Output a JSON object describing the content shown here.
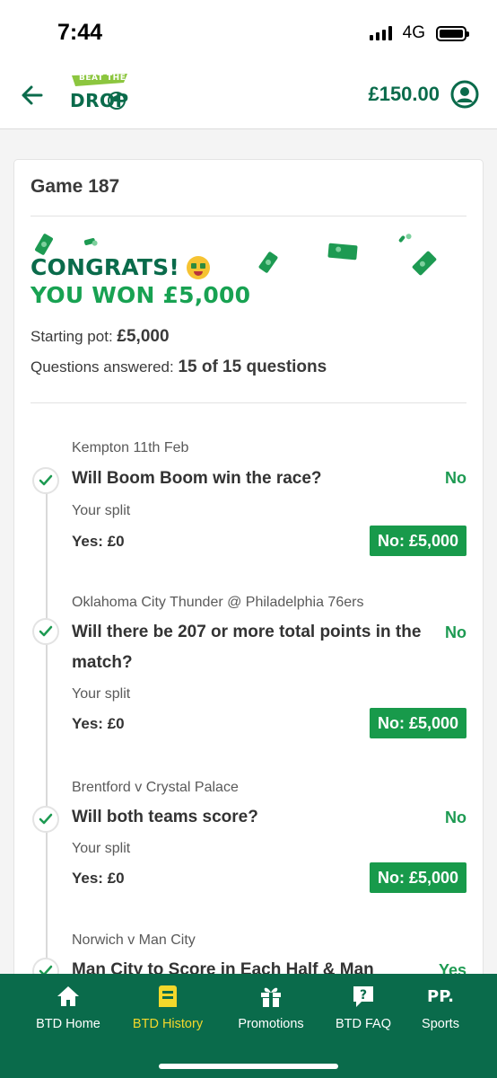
{
  "status": {
    "time": "7:44",
    "network": "4G"
  },
  "header": {
    "logo_top": "BEAT THE",
    "logo_bottom": "DROP",
    "balance": "£150.00"
  },
  "game": {
    "title": "Game 187",
    "congrats": "CONGRATS!",
    "won": "YOU WON £5,000",
    "starting_pot_label": "Starting pot:",
    "starting_pot_value": "£5,000",
    "questions_label": "Questions answered:",
    "questions_value": "15 of 15 questions"
  },
  "questions": [
    {
      "event": "Kempton 11th Feb",
      "text": "Will Boom Boom win the race?",
      "answer": "No",
      "split_label": "Your split",
      "yes": "Yes: £0",
      "no": "No: £5,000"
    },
    {
      "event": "Oklahoma City Thunder @ Philadelphia 76ers",
      "text": "Will there be 207 or more total points in the match?",
      "answer": "No",
      "split_label": "Your split",
      "yes": "Yes: £0",
      "no": "No: £5,000"
    },
    {
      "event": "Brentford v Crystal Palace",
      "text": "Will both teams score?",
      "answer": "No",
      "split_label": "Your split",
      "yes": "Yes: £0",
      "no": "No: £5,000"
    },
    {
      "event": "Norwich v Man City",
      "text": "Man City to Score in Each Half & Man",
      "answer": "Yes"
    }
  ],
  "nav": [
    {
      "label": "BTD Home",
      "icon": "home-icon",
      "active": false
    },
    {
      "label": "BTD History",
      "icon": "history-icon",
      "active": true
    },
    {
      "label": "Promotions",
      "icon": "gift-icon",
      "active": false
    },
    {
      "label": "BTD FAQ",
      "icon": "faq-icon",
      "active": false
    },
    {
      "label": "Sports",
      "icon": "pp-icon",
      "active": false
    }
  ],
  "colors": {
    "brand_dark": "#0a6b4b",
    "brand_green": "#189a4b",
    "nav_active": "#f3d82b"
  }
}
